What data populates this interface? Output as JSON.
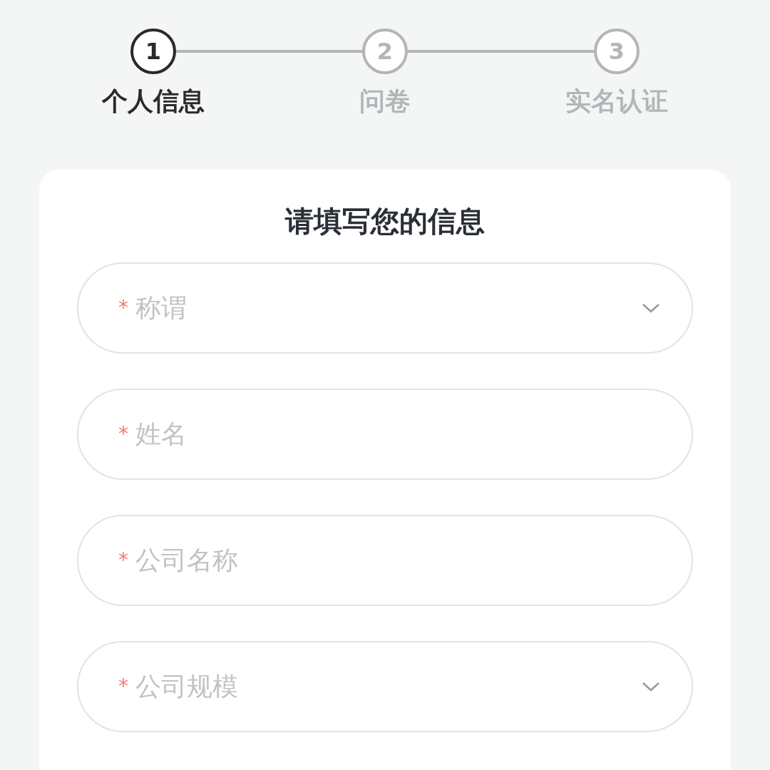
{
  "steps": [
    {
      "number": "1",
      "label": "个人信息",
      "current": true
    },
    {
      "number": "2",
      "label": "问卷",
      "current": false
    },
    {
      "number": "3",
      "label": "实名认证",
      "current": false
    }
  ],
  "form": {
    "title": "请填写您的信息",
    "fields": [
      {
        "kind": "select",
        "required_mark": "*",
        "placeholder": "称谓"
      },
      {
        "kind": "text",
        "required_mark": "*",
        "placeholder": "姓名"
      },
      {
        "kind": "text",
        "required_mark": "*",
        "placeholder": "公司名称"
      },
      {
        "kind": "select",
        "required_mark": "*",
        "placeholder": "公司规模"
      }
    ]
  }
}
